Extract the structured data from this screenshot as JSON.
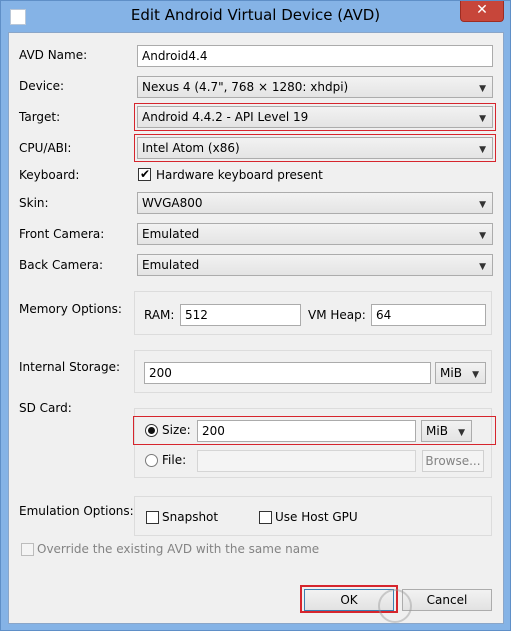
{
  "window": {
    "title": "Edit Android Virtual Device (AVD)",
    "close_glyph": "✕"
  },
  "fields": {
    "avd_name_label": "AVD Name:",
    "avd_name_value": "Android4.4",
    "device_label": "Device:",
    "device_value": "Nexus 4 (4.7\", 768 × 1280: xhdpi)",
    "target_label": "Target:",
    "target_value": "Android 4.4.2 - API Level 19",
    "cpu_label": "CPU/ABI:",
    "cpu_value": "Intel Atom (x86)",
    "keyboard_label": "Keyboard:",
    "keyboard_checkbox_label": "Hardware keyboard present",
    "keyboard_checked": true,
    "skin_label": "Skin:",
    "skin_value": "WVGA800",
    "front_camera_label": "Front Camera:",
    "front_camera_value": "Emulated",
    "back_camera_label": "Back Camera:",
    "back_camera_value": "Emulated"
  },
  "memory": {
    "label": "Memory Options:",
    "ram_label": "RAM:",
    "ram_value": "512",
    "vm_heap_label": "VM Heap:",
    "vm_heap_value": "64"
  },
  "storage": {
    "label": "Internal Storage:",
    "value": "200",
    "unit": "MiB"
  },
  "sd_card": {
    "label": "SD Card:",
    "size_label": "Size:",
    "size_value": "200",
    "size_unit": "MiB",
    "file_label": "File:",
    "file_value": "",
    "browse_label": "Browse..."
  },
  "emulation": {
    "label": "Emulation Options:",
    "snapshot_label": "Snapshot",
    "host_gpu_label": "Use Host GPU"
  },
  "override_label": "Override the existing AVD with the same name",
  "buttons": {
    "ok": "OK",
    "cancel": "Cancel"
  },
  "icons": {
    "dropdown": "▼",
    "checkmark": "✔"
  },
  "colors": {
    "highlight": "#d6252d",
    "title_bar": "#85b3e6"
  }
}
